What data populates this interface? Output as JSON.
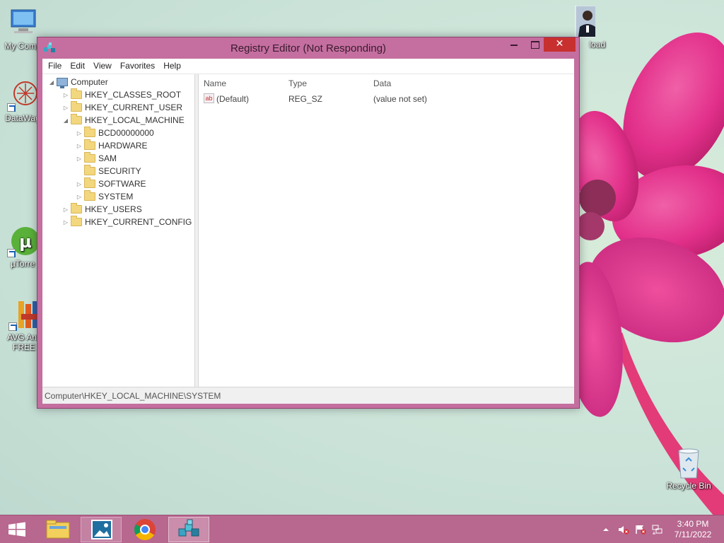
{
  "desktop": {
    "icons": [
      {
        "label": "My Comp"
      },
      {
        "label": "DataWag"
      },
      {
        "label": "µTorre"
      },
      {
        "label": "AVG Anti FREE"
      },
      {
        "label": "load"
      },
      {
        "label": "Recycle Bin"
      }
    ]
  },
  "window": {
    "title": "Registry Editor (Not Responding)",
    "close_symbol": "✕",
    "menu": [
      "File",
      "Edit",
      "View",
      "Favorites",
      "Help"
    ],
    "tree": {
      "root": "Computer",
      "items": [
        {
          "label": "HKEY_CLASSES_ROOT",
          "expanded": false
        },
        {
          "label": "HKEY_CURRENT_USER",
          "expanded": false
        },
        {
          "label": "HKEY_LOCAL_MACHINE",
          "expanded": true
        },
        {
          "label": "BCD00000000",
          "expanded": false
        },
        {
          "label": "HARDWARE",
          "expanded": false
        },
        {
          "label": "SAM",
          "expanded": false
        },
        {
          "label": "SECURITY",
          "expanded": false
        },
        {
          "label": "SOFTWARE",
          "expanded": false
        },
        {
          "label": "SYSTEM",
          "expanded": false
        },
        {
          "label": "HKEY_USERS",
          "expanded": false
        },
        {
          "label": "HKEY_CURRENT_CONFIG",
          "expanded": false
        }
      ]
    },
    "list": {
      "columns": [
        "Name",
        "Type",
        "Data"
      ],
      "rows": [
        {
          "icon": "ab",
          "name": "(Default)",
          "type": "REG_SZ",
          "data": "(value not set)"
        }
      ]
    },
    "status_path": "Computer\\HKEY_LOCAL_MACHINE\\SYSTEM"
  },
  "taskbar": {
    "time": "3:40 PM",
    "date": "7/11/2022",
    "tray_icons": [
      "show-hidden-icons",
      "volume-muted-icon",
      "action-center-flag-icon",
      "network-icon"
    ]
  },
  "colors": {
    "titlebar": "#c46fa0",
    "close_button": "#c7302f",
    "taskbar": "#b8678f"
  }
}
